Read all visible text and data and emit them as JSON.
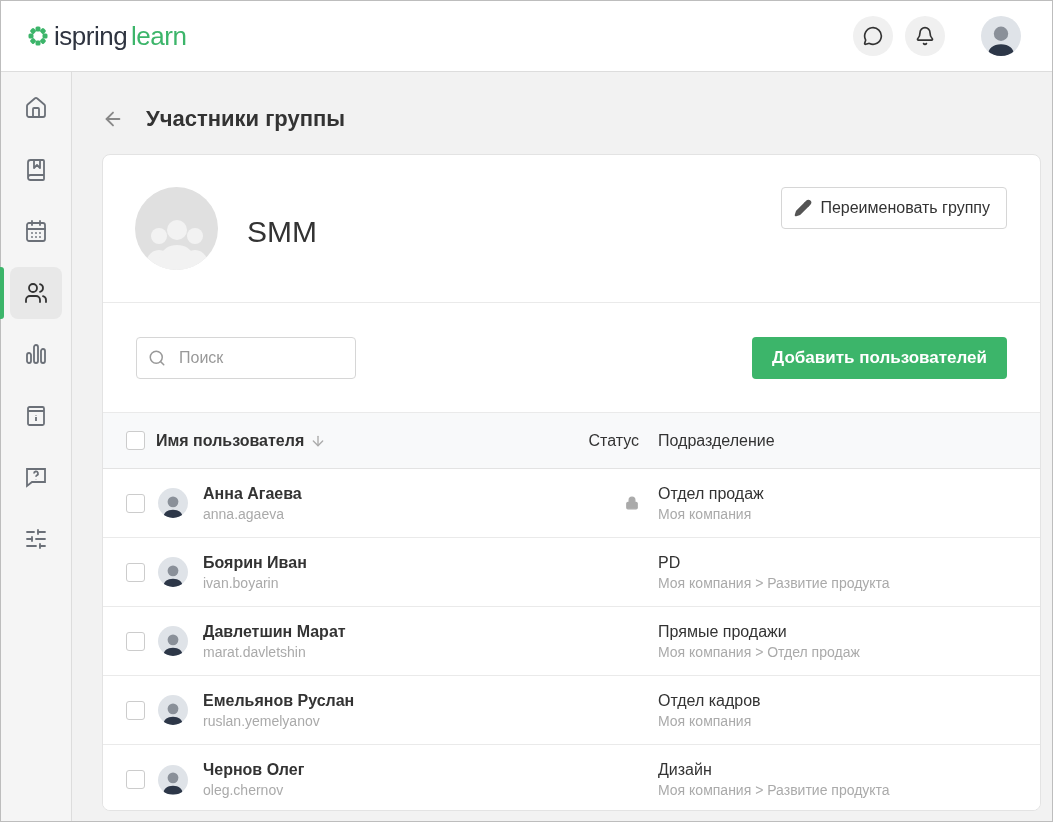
{
  "header": {
    "logo": {
      "brand": "ispring",
      "product": "learn"
    }
  },
  "sidebar": {
    "items": [
      {
        "kind": "home",
        "selected": false
      },
      {
        "kind": "book",
        "selected": false
      },
      {
        "kind": "calendar",
        "selected": false
      },
      {
        "kind": "users",
        "selected": true
      },
      {
        "kind": "chart",
        "selected": false
      },
      {
        "kind": "info",
        "selected": false
      },
      {
        "kind": "question",
        "selected": false
      },
      {
        "kind": "sliders",
        "selected": false
      }
    ]
  },
  "page": {
    "title": "Участники группы"
  },
  "group": {
    "name": "SMM",
    "rename_button": "Переименовать группу"
  },
  "search": {
    "placeholder": "Поиск"
  },
  "add_button": "Добавить пользователей",
  "table": {
    "checked": false,
    "columns": [
      "Имя пользователя",
      "Статус",
      "Подразделение"
    ],
    "rows": [
      {
        "checked": false,
        "name": "Анна Агаева",
        "login": "anna.agaeva",
        "locked": true,
        "department": "Отдел продаж",
        "path": "Моя компания"
      },
      {
        "checked": false,
        "name": "Боярин Иван",
        "login": "ivan.boyarin",
        "locked": false,
        "department": "PD",
        "path": "Моя компания > Развитие продукта"
      },
      {
        "checked": false,
        "name": "Давлетшин Марат",
        "login": "marat.davletshin",
        "locked": false,
        "department": "Прямые продажи",
        "path": "Моя компания > Отдел продаж"
      },
      {
        "checked": false,
        "name": "Емельянов Руслан",
        "login": "ruslan.yemelyanov",
        "locked": false,
        "department": "Отдел кадров",
        "path": "Моя компания"
      },
      {
        "checked": false,
        "name": "Чернов Олег",
        "login": "oleg.chernov",
        "locked": false,
        "department": "Дизайн",
        "path": "Моя компания > Развитие продукта"
      }
    ]
  }
}
